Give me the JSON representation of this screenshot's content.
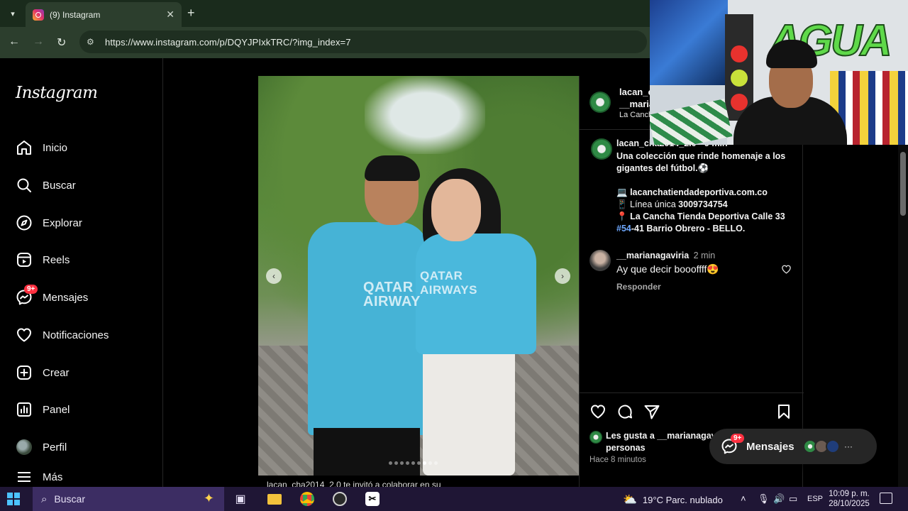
{
  "browser": {
    "tab_title": "(9) Instagram",
    "tab_close": "✕",
    "new_tab": "+",
    "url": "https://www.instagram.com/p/DQYJPIxkTRC/?img_index=7"
  },
  "sidebar": {
    "logo": "Instagram",
    "messages_badge": "9+",
    "items": [
      {
        "label": "Inicio",
        "icon": "home-icon"
      },
      {
        "label": "Buscar",
        "icon": "search-icon"
      },
      {
        "label": "Explorar",
        "icon": "compass-icon"
      },
      {
        "label": "Reels",
        "icon": "reels-icon"
      },
      {
        "label": "Mensajes",
        "icon": "messenger-icon"
      },
      {
        "label": "Notificaciones",
        "icon": "heart-icon"
      },
      {
        "label": "Crear",
        "icon": "plus-square-icon"
      },
      {
        "label": "Panel",
        "icon": "chart-icon"
      },
      {
        "label": "Perfil",
        "icon": "avatar"
      },
      {
        "label": "Más",
        "icon": "menu-icon"
      }
    ]
  },
  "post": {
    "photo_text_left": "QATAR AIRWAY",
    "photo_text_right": "QATAR AIRWAYS",
    "carousel_count": 9,
    "carousel_active": 7,
    "caption_peek": "lacan_cha2014_2.0 te invitó a colaborar en su"
  },
  "panel": {
    "header_user": "lacan_c",
    "header_coauthor": "__maria",
    "header_location": "La Cancha",
    "caption_user": "lacan_cha2014_2.0 • 9 min",
    "caption_line1": "Una colección que rinde homenaje a los",
    "caption_line2": "gigantes del fútbol.⚽",
    "caption_web_prefix": "💻",
    "caption_web": "lacanchatiendadeportiva.com.co",
    "caption_phone_prefix": "📱 Línea única",
    "caption_phone": "3009734754",
    "caption_addr_prefix": "📍",
    "caption_addr_name": "La Cancha Tienda Deportiva",
    "caption_addr_rest": "Calle 33",
    "caption_addr_hash": "#54",
    "caption_addr_end": "-41 Barrio Obrero - BELLO.",
    "comment_user": "__marianagaviria",
    "comment_time": "2 min",
    "comment_text": "Ay que decir boooffff😍",
    "reply_label": "Responder",
    "likes_line1": "Les gusta a __marianagaviri",
    "likes_line2": "personas",
    "time_ago": "Hace 8 minutos"
  },
  "messages_pill": {
    "label": "Mensajes",
    "badge": "9+",
    "more": "···"
  },
  "webcam": {
    "graffiti": "AGUA"
  },
  "taskbar": {
    "search_label": "Buscar",
    "weather": "19°C  Parc. nublado",
    "language": "ESP",
    "time": "10:09 p. m.",
    "date": "28/10/2025"
  }
}
